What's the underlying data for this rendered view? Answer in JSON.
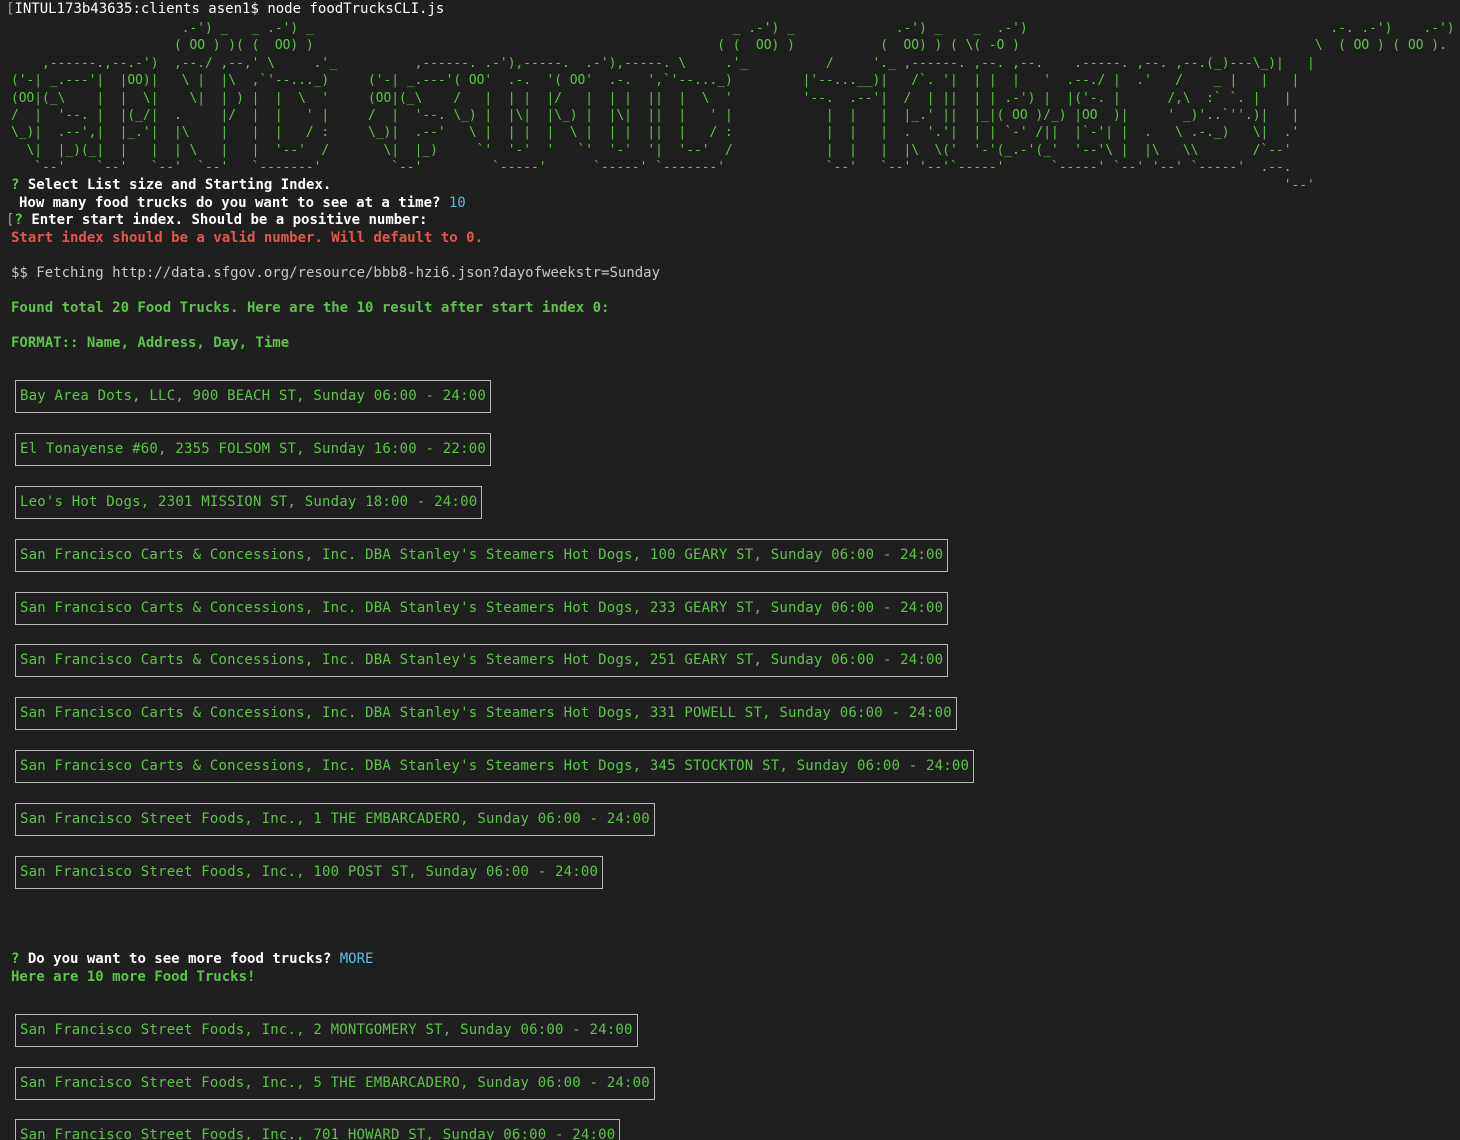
{
  "prompt": {
    "host": "INTUL173b43635:clients asen1$",
    "command": "node foodTrucksCLI.js"
  },
  "banner_ascii": "                      .-') _   _ .-') _                                                      _ .-') _             .-') _    _  .-')                                       .-. .-')    .-')    ,---.\n                     ( OO ) )( (  OO) )                                                    ( (  OO) )           (  OO) ) ( \\( -O )                                      \\  ( OO ) ( OO ).  |   |\n    ,------.,--.-')  ,--./ ,--,' \\     .'_          ,------. .-'),-----.  .-'),-----. \\     .'_          /     '._ ,------. ,--. ,--.    .-----. ,--. ,--.(_)---\\_)|   |\n('-| _.---'|  |OO)|   \\ |  |\\  ,`'--..._)     ('-| _.---'( OO'  .-.  '( OO'  .-.  ',`'--..._)         |'--...__)|   /`. '|  | |  |   '  .--./ |  .'   /    _ |   |   |\n(OO|(_\\    |  |  \\|    \\|  | ) |  |  \\  '     (OO|(_\\    /   |  | |  |/   |  | |  ||  |  \\  '         '--.  .--'|  /  | ||  | | .-') |  |('-. |      /,\\  :` `. |   |\n/  |  '--. |  |(_/|  .     |/  |  |   ' |     /  |  '--. \\_) |  |\\|  |\\_) |  |\\|  ||  |   ' |            |  |   |  |_.' ||  |_|( OO )/_) |OO  )|     ' _)'..`''.)|   |\n\\_)|  .--',|  |_.'|  |\\    |   |  |   / :     \\_)|  .--'   \\ |  | |  |  \\ |  | |  ||  |   / :            |  |   |  .  '.'|  | | `-' /||  |`-'| |  .   \\ .-._)   \\|  .'\n  \\|  |_)(_|  |   |  | \\   |   |  '--'  /       \\|  |_)     `'  '-'  '   `'  '-'  '|  '--'  /            |  |   |  |\\  \\('  '-'(_.-'(_'  '--'\\ |  |\\   \\\\       /`--'\n   `--'    `--'   `--'  `--'   `-------'         `--'         `-----'      `-----' `-------'             `--'   `--' '--'`-----'      `-----' `--' '--' `-----'  .--.\n                                                                                                                                                                    '--'",
  "q1": {
    "mark": "?",
    "title": "Select List size and Starting Index.",
    "size_question": "How many food trucks do you want to see at a time?",
    "size_answer": "10",
    "index_question": "Enter start index. Should be a positive number:",
    "index_error": "Start index should be a valid number. Will default to 0."
  },
  "fetch": {
    "text": "$$ Fetching http://data.sfgov.org/resource/bbb8-hzi6.json?dayofweekstr=Sunday"
  },
  "summary": {
    "found": "Found total 20 Food Trucks. Here are the 10 result after start index 0:",
    "format": "FORMAT:: Name, Address, Day, Time"
  },
  "results_page1": [
    "Bay Area Dots, LLC, 900 BEACH ST, Sunday 06:00 - 24:00",
    "El Tonayense #60, 2355 FOLSOM ST, Sunday 16:00 - 22:00",
    "Leo's Hot Dogs, 2301 MISSION ST, Sunday 18:00 - 24:00",
    "San Francisco Carts & Concessions, Inc. DBA Stanley's Steamers Hot Dogs, 100 GEARY ST, Sunday 06:00 - 24:00",
    "San Francisco Carts & Concessions, Inc. DBA Stanley's Steamers Hot Dogs, 233 GEARY ST, Sunday 06:00 - 24:00",
    "San Francisco Carts & Concessions, Inc. DBA Stanley's Steamers Hot Dogs, 251 GEARY ST, Sunday 06:00 - 24:00",
    "San Francisco Carts & Concessions, Inc. DBA Stanley's Steamers Hot Dogs, 331 POWELL ST, Sunday 06:00 - 24:00",
    "San Francisco Carts & Concessions, Inc. DBA Stanley's Steamers Hot Dogs, 345 STOCKTON ST, Sunday 06:00 - 24:00",
    "San Francisco Street Foods, Inc., 1 THE EMBARCADERO, Sunday 06:00 - 24:00",
    "San Francisco Street Foods, Inc., 100 POST ST, Sunday 06:00 - 24:00"
  ],
  "q2": {
    "mark": "?",
    "question": "Do you want to see more food trucks?",
    "answer": "MORE",
    "more_msg": "Here are 10 more Food Trucks!"
  },
  "results_page2": [
    "San Francisco Street Foods, Inc., 2 MONTGOMERY ST, Sunday 06:00 - 24:00",
    "San Francisco Street Foods, Inc., 5 THE EMBARCADERO, Sunday 06:00 - 24:00",
    "San Francisco Street Foods, Inc., 701 HOWARD ST, Sunday 06:00 - 24:00"
  ],
  "colors": {
    "background": "#1f1f1f",
    "green": "#5ec449",
    "red": "#e2574b",
    "cyan": "#57c2e0",
    "box_border": "#b8b8b8"
  }
}
